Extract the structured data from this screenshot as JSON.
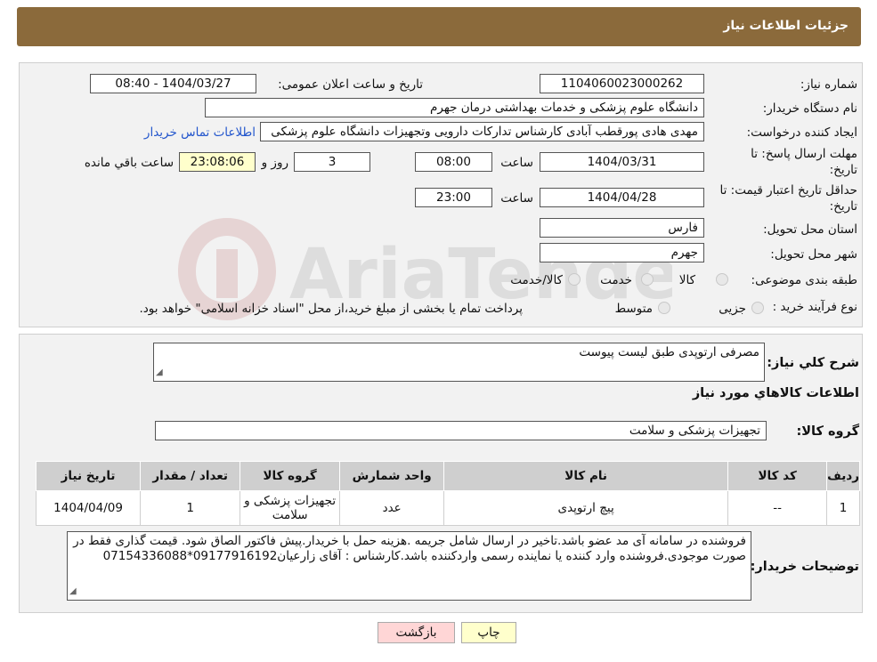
{
  "header": {
    "title": "جزئیات اطلاعات نیاز"
  },
  "form": {
    "need_number_label": "شماره نیاز:",
    "need_number": "1104060023000262",
    "announce_label": "تاریخ و ساعت اعلان عمومی:",
    "announce_value": "1404/03/27 - 08:40",
    "buyer_org_label": "نام دستگاه خریدار:",
    "buyer_org": "دانشگاه علوم پزشکی و خدمات بهداشتی  درمان جهرم",
    "requester_label": "ایجاد کننده درخواست:",
    "requester": "مهدی هادی پورقطب آبادی کارشناس تدارکات دارویی وتجهیزات دانشگاه علوم پزشکی",
    "contact_link": "اطلاعات تماس خریدار",
    "deadline_label_1": "مهلت ارسال پاسخ: تا",
    "deadline_label_2": "تاریخ:",
    "deadline_date": "1404/03/31",
    "time_label": "ساعت",
    "deadline_time": "08:00",
    "days_value": "3",
    "days_label": "روز و",
    "remaining_time": "23:08:06",
    "remaining_label": "ساعت باقي مانده",
    "validity_label_1": "حداقل تاریخ اعتبار قیمت: تا",
    "validity_label_2": "تاریخ:",
    "validity_date": "1404/04/28",
    "validity_time": "23:00",
    "province_label": "استان محل تحویل:",
    "province": "فارس",
    "city_label": "شهر محل تحویل:",
    "city": "جهرم",
    "category_label": "طبقه بندی موضوعی:",
    "category_options": [
      "کالا",
      "خدمت",
      "کالا/خدمت"
    ],
    "process_label": "نوع فرآیند خرید :",
    "process_options": [
      "جزیی",
      "متوسط"
    ],
    "process_note": "پرداخت تمام یا بخشی از مبلغ خرید،از محل \"اسناد خزانه اسلامی\" خواهد بود."
  },
  "details": {
    "summary_label": "شرح کلي نياز:",
    "summary": "مصرفی ارتوپدی طبق لیست پیوست",
    "goods_info_title": "اطلاعات کالاهاي مورد نياز",
    "goods_group_label": "گروه کالا:",
    "goods_group": "تجهیزات پزشکی و سلامت",
    "table": {
      "headers": [
        "رديف",
        "کد کالا",
        "نام کالا",
        "واحد شمارش",
        "گروه کالا",
        "تعداد / مقدار",
        "تاریخ نیاز"
      ],
      "rows": [
        [
          "1",
          "--",
          "پیچ ارتوپدی",
          "عدد",
          "تجهیزات پزشکی و سلامت",
          "1",
          "1404/04/09"
        ]
      ]
    },
    "buyer_notes_label": "توضیحات خریدار:",
    "buyer_notes": "فروشنده در سامانه آی مد عضو باشد.تاخیر در ارسال شامل جریمه .هزینه حمل با خریدار.پیش فاکتور الصاق شود. قیمت گذاری فقط در صورت موجودی.فروشنده وارد کننده یا نماینده رسمی واردکننده باشد.کارشناس : آقای زارعیان09177916192*07154336088"
  },
  "buttons": {
    "print": "چاپ",
    "back": "بازگشت"
  },
  "watermark": {
    "text": "AriaTender.neT"
  }
}
